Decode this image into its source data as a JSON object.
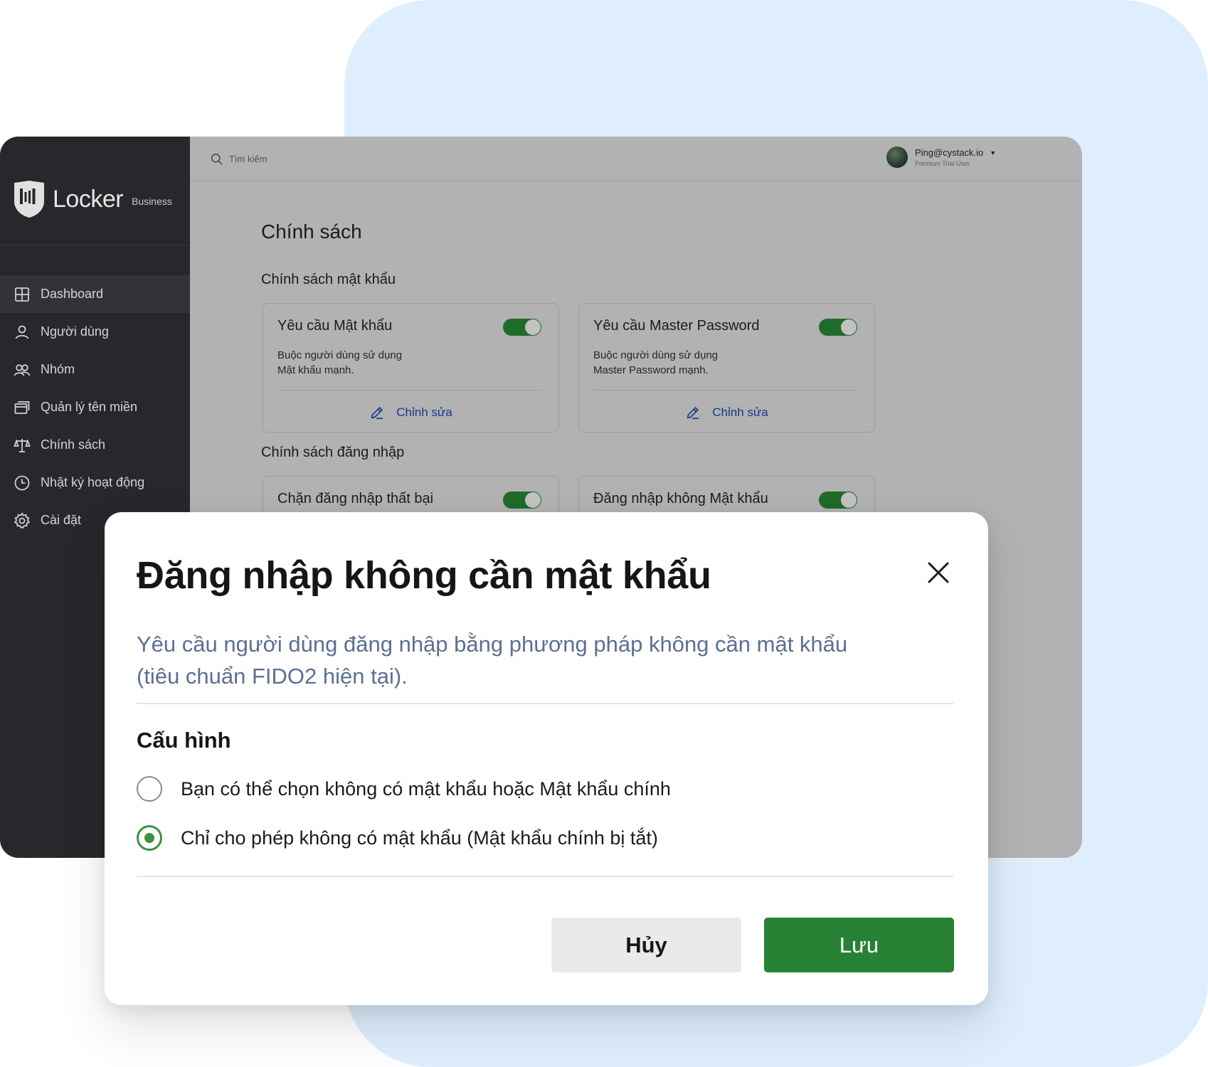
{
  "colors": {
    "background_accent": "#deeefd",
    "sidebar_bg": "#27282b",
    "overlay_main_bg": "#b2b2b2",
    "primary_green": "#278236",
    "radio_green": "#3a9243",
    "link_blue": "#143a8c",
    "modal_desc": "#5c6f93"
  },
  "sidebar": {
    "logo_icon": "shield-logo-icon",
    "brand": "Locker",
    "brand_sub": "Business",
    "items": [
      {
        "label": "Dashboard",
        "icon": "grid-icon",
        "active": true
      },
      {
        "label": "Người dùng",
        "icon": "user-icon",
        "active": false
      },
      {
        "label": "Nhóm",
        "icon": "users-icon",
        "active": false
      },
      {
        "label": "Quản lý tên miền",
        "icon": "window-stack-icon",
        "active": false
      },
      {
        "label": "Chính sách",
        "icon": "balance-scale-icon",
        "active": false
      },
      {
        "label": "Nhật ký hoạt động",
        "icon": "clock-icon",
        "active": false
      },
      {
        "label": "Cài đặt",
        "icon": "gear-icon",
        "active": false
      }
    ]
  },
  "topbar": {
    "search_placeholder": "Tìm kiếm",
    "user_email": "Ping@cystack.io",
    "user_plan": "Premium Trial User"
  },
  "page": {
    "title": "Chính sách",
    "sections": [
      {
        "title": "Chính sách mật khẩu",
        "cards": [
          {
            "title": "Yêu cầu Mật khẩu",
            "desc_line1": "Buộc người dùng sử dụng",
            "desc_line2": "Mật khẩu mạnh.",
            "enabled": true,
            "edit_label": "Chỉnh sửa"
          },
          {
            "title": "Yêu cầu Master Password",
            "desc_line1": "Buộc người dùng sử dụng",
            "desc_line2": "Master Password mạnh.",
            "enabled": true,
            "edit_label": "Chỉnh sửa"
          }
        ]
      },
      {
        "title": "Chính sách đăng nhập",
        "cards": [
          {
            "title": "Chặn đăng nhập thất bại",
            "enabled": true
          },
          {
            "title": "Đăng nhập không Mật khẩu",
            "enabled": true
          }
        ]
      }
    ]
  },
  "modal": {
    "title": "Đăng nhập không cần mật khẩu",
    "description": "Yêu cầu người dùng đăng nhập bằng phương pháp không cần mật khẩu (tiêu chuẩn FIDO2 hiện tại).",
    "config_title": "Cấu hình",
    "options": [
      {
        "label": "Bạn có thể chọn không có mật khẩu hoặc Mật khẩu chính",
        "checked": false
      },
      {
        "label": "Chỉ cho phép không có mật khẩu (Mật khẩu chính bị tắt)",
        "checked": true
      }
    ],
    "cancel_label": "Hủy",
    "save_label": "Lưu"
  }
}
